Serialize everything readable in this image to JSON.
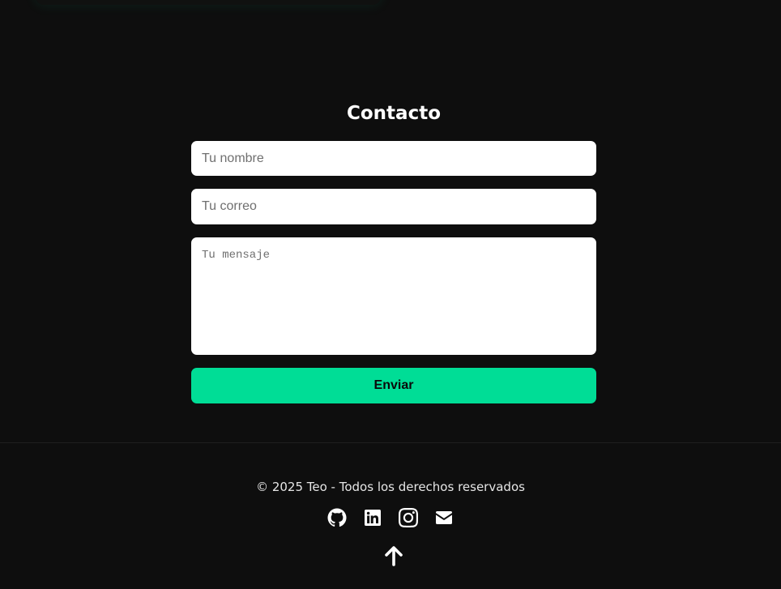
{
  "contact": {
    "title": "Contacto",
    "name_placeholder": "Tu nombre",
    "email_placeholder": "Tu correo",
    "message_placeholder": "Tu mensaje",
    "submit_label": "Enviar"
  },
  "footer": {
    "copyright": "© 2025 Teo - Todos los derechos reservados",
    "socials": [
      "github-icon",
      "linkedin-icon",
      "instagram-icon",
      "envelope-icon"
    ],
    "back_to_top_icon": "arrow-up-icon"
  },
  "colors": {
    "background": "#0e0e0e",
    "accent": "#00dd96",
    "field_background": "#ffffff",
    "text": "#ffffff"
  }
}
